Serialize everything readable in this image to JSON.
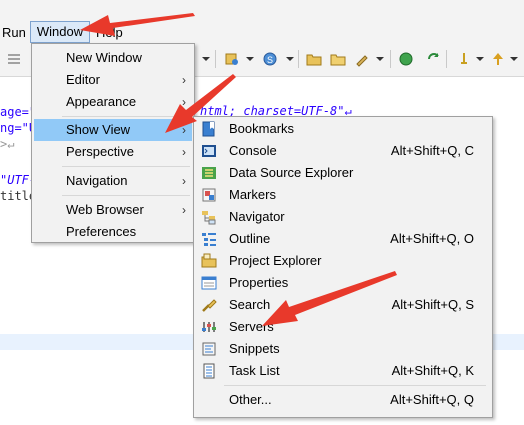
{
  "menubar": {
    "run": "Run",
    "window": "Window",
    "help": "Help"
  },
  "editor": {
    "lines": [
      "age=\"",
      "ng=\"U",
      ">↵",
      "",
      "\"UTF-",
      "title"
    ],
    "header_snippet": "html; charset=UTF-8\"↵"
  },
  "window_menu": {
    "items": [
      {
        "label": "New Window",
        "submenu": false
      },
      {
        "label": "Editor",
        "submenu": true
      },
      {
        "label": "Appearance",
        "submenu": true
      },
      {
        "label": "Show View",
        "submenu": true,
        "selected": true
      },
      {
        "label": "Perspective",
        "submenu": true
      },
      {
        "label": "Navigation",
        "submenu": true
      },
      {
        "label": "Web Browser",
        "submenu": true
      },
      {
        "label": "Preferences",
        "submenu": false
      }
    ],
    "arrow_glyph": "›"
  },
  "show_view_menu": {
    "items": [
      {
        "label": "Bookmarks",
        "shortcut": "",
        "icon": "bookmarks-icon"
      },
      {
        "label": "Console",
        "shortcut": "Alt+Shift+Q, C",
        "icon": "console-icon"
      },
      {
        "label": "Data Source Explorer",
        "shortcut": "",
        "icon": "data-source-explorer-icon"
      },
      {
        "label": "Markers",
        "shortcut": "",
        "icon": "markers-icon"
      },
      {
        "label": "Navigator",
        "shortcut": "",
        "icon": "navigator-icon"
      },
      {
        "label": "Outline",
        "shortcut": "Alt+Shift+Q, O",
        "icon": "outline-icon"
      },
      {
        "label": "Project Explorer",
        "shortcut": "",
        "icon": "project-explorer-icon"
      },
      {
        "label": "Properties",
        "shortcut": "",
        "icon": "properties-icon"
      },
      {
        "label": "Search",
        "shortcut": "Alt+Shift+Q, S",
        "icon": "search-icon"
      },
      {
        "label": "Servers",
        "shortcut": "",
        "icon": "servers-icon"
      },
      {
        "label": "Snippets",
        "shortcut": "",
        "icon": "snippets-icon"
      },
      {
        "label": "Task List",
        "shortcut": "Alt+Shift+Q, K",
        "icon": "task-list-icon"
      },
      {
        "label": "Other...",
        "shortcut": "Alt+Shift+Q, Q",
        "icon": ""
      }
    ]
  },
  "colors": {
    "menu_bg": "#f2f2f2",
    "selection": "#91c9f7",
    "annotation_arrow": "#e8392b"
  }
}
